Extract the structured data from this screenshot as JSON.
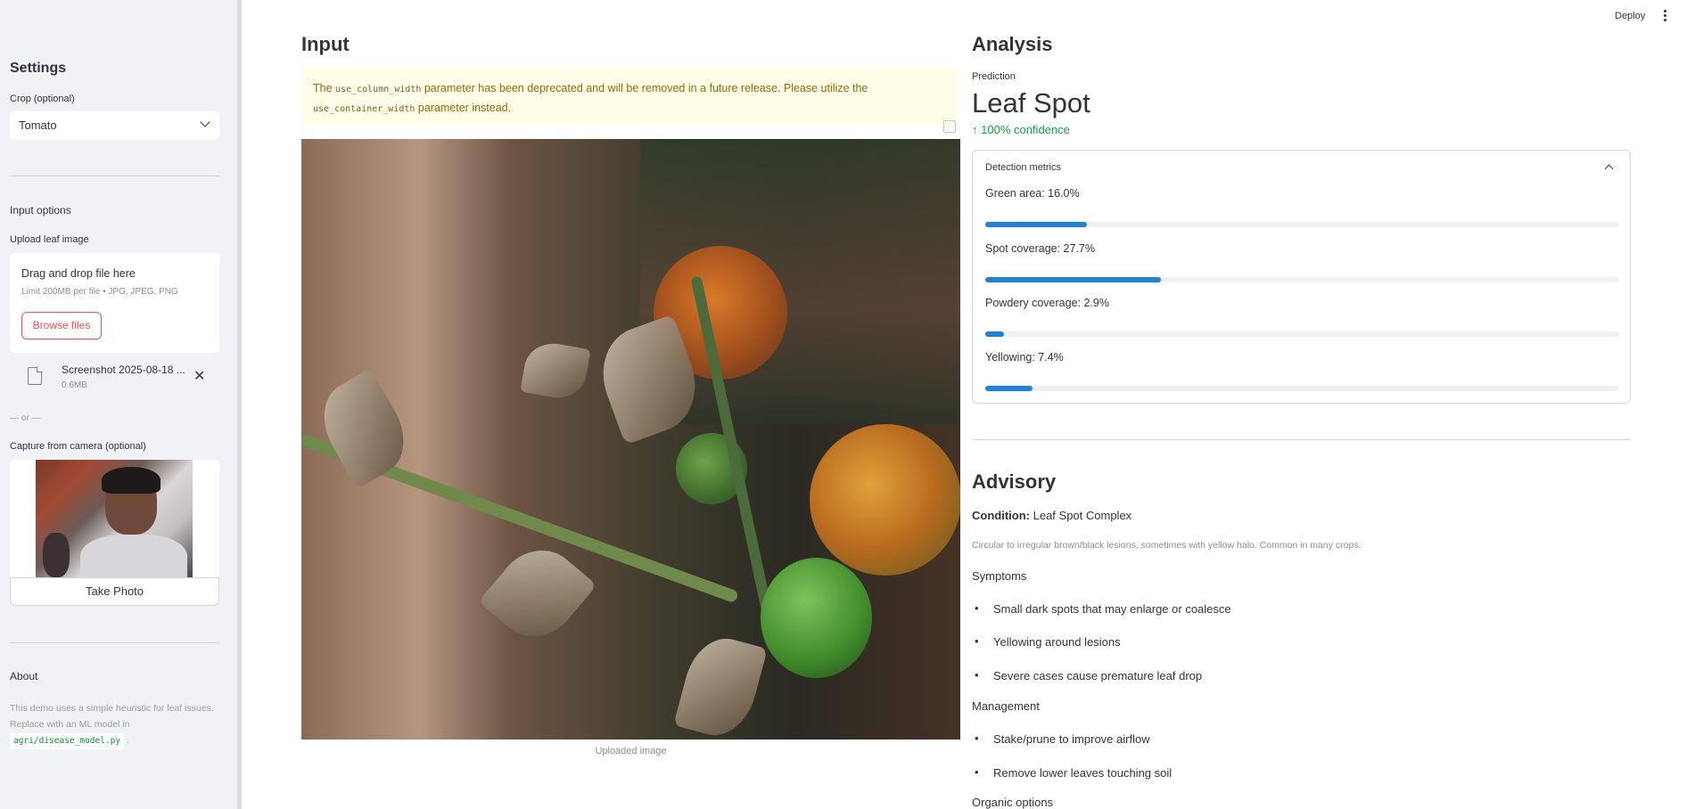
{
  "header": {
    "deploy_label": "Deploy"
  },
  "sidebar": {
    "title": "Settings",
    "crop_label": "Crop (optional)",
    "crop_value": "Tomato",
    "input_options_heading": "Input options",
    "upload_label": "Upload leaf image",
    "dropzone_title": "Drag and drop file here",
    "dropzone_limit": "Limit 200MB per file • JPG, JPEG, PNG",
    "browse_label": "Browse files",
    "file_name": "Screenshot 2025-08-18 ...",
    "file_size": "0.6MB",
    "or_text": "— or —",
    "camera_label": "Capture from camera (optional)",
    "take_photo_label": "Take Photo",
    "about_heading": "About",
    "about_text": "This demo uses a simple heuristic for leaf issues. Replace with an ML model in",
    "about_code": "agri/disease_model.py",
    "about_tail": "."
  },
  "input": {
    "heading": "Input",
    "warning_pre": "The",
    "warning_code1": "use_column_width",
    "warning_mid": "parameter has been deprecated and will be removed in a future release. Please utilize the",
    "warning_code2": "use_container_width",
    "warning_post": "parameter instead.",
    "image_caption": "Uploaded image"
  },
  "analysis": {
    "heading": "Analysis",
    "prediction_label": "Prediction",
    "prediction_value": "Leaf Spot",
    "confidence_text": "100% confidence",
    "metrics_title": "Detection metrics",
    "metrics": [
      {
        "label": "Green area: 16.0%",
        "value": 0.16
      },
      {
        "label": "Spot coverage: 27.7%",
        "value": 0.277
      },
      {
        "label": "Powdery coverage: 2.9%",
        "value": 0.029
      },
      {
        "label": "Yellowing: 7.4%",
        "value": 0.074
      }
    ]
  },
  "advisory": {
    "heading": "Advisory",
    "condition_label": "Condition:",
    "condition_value": "Leaf Spot Complex",
    "description": "Circular to irregular brown/black lesions, sometimes with yellow halo. Common in many crops.",
    "symptoms_heading": "Symptoms",
    "symptoms": [
      "Small dark spots that may enlarge or coalesce",
      "Yellowing around lesions",
      "Severe cases cause premature leaf drop"
    ],
    "management_heading": "Management",
    "management": [
      "Stake/prune to improve airflow",
      "Remove lower leaves touching soil"
    ],
    "organic_heading": "Organic options"
  },
  "colors": {
    "accent": "#ff4b4b",
    "progress": "#1c83e1",
    "delta_green": "#09ab3b",
    "warning_bg": "#fffce8"
  }
}
